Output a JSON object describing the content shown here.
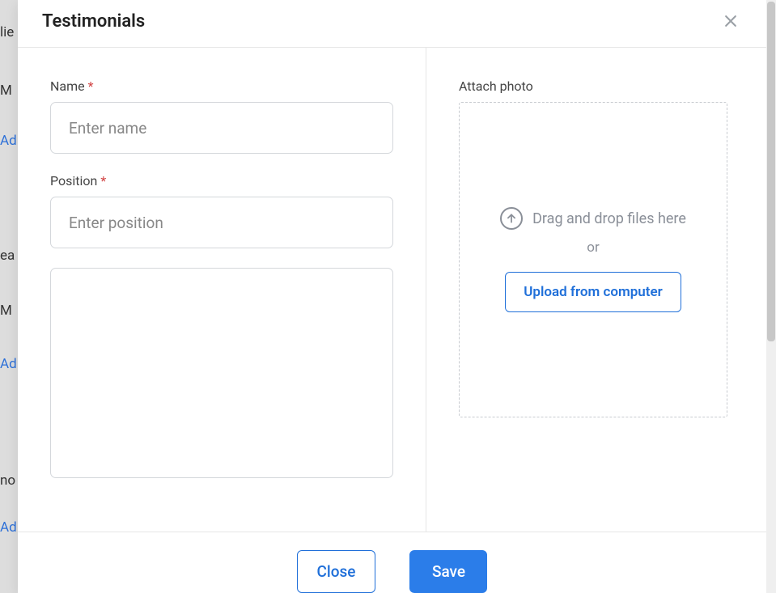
{
  "modal": {
    "title": "Testimonials",
    "form": {
      "name_label": "Name",
      "name_placeholder": "Enter name",
      "name_value": "",
      "position_label": "Position",
      "position_placeholder": "Enter position",
      "position_value": "",
      "content_value": ""
    },
    "upload": {
      "attach_label": "Attach photo",
      "drag_text": "Drag and drop files here",
      "or_text": "or",
      "upload_button": "Upload from computer"
    },
    "footer": {
      "close_label": "Close",
      "save_label": "Save"
    }
  },
  "backdrop": {
    "fragments": [
      "lie",
      "M",
      "Ad",
      "ea",
      "M",
      "Ad",
      "no",
      "Ad"
    ]
  },
  "required_marker": "*"
}
